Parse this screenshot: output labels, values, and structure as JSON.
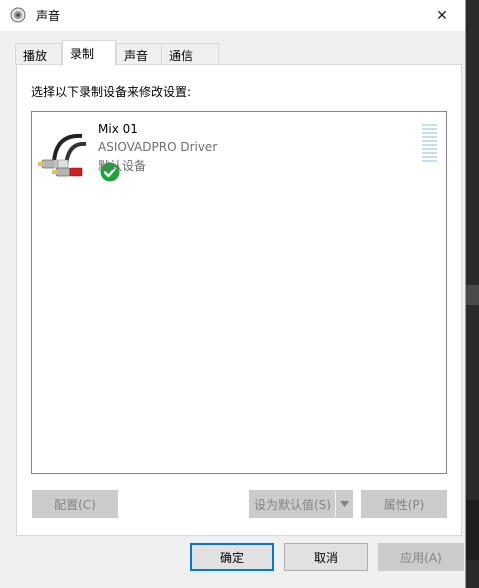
{
  "window": {
    "title": "声音",
    "close_glyph": "✕"
  },
  "tabs": [
    {
      "label": "播放",
      "active": false
    },
    {
      "label": "录制",
      "active": true
    },
    {
      "label": "声音",
      "active": false
    },
    {
      "label": "通信",
      "active": false
    }
  ],
  "panel": {
    "instruction": "选择以下录制设备来修改设置:",
    "devices": [
      {
        "name": "Mix 01",
        "driver": "ASIOVADPRO Driver",
        "status": "默认设备",
        "icon": "rca-cable-icon",
        "status_icon": "default-check-icon",
        "status_color": "#1aa63a"
      }
    ],
    "buttons": {
      "configure": "配置(C)",
      "set_default": "设为默认值(S)",
      "properties": "属性(P)"
    }
  },
  "dialog_buttons": {
    "ok": "确定",
    "cancel": "取消",
    "apply": "应用(A)"
  },
  "colors": {
    "accent": "#0078d7",
    "meter": "#c8dde8"
  }
}
